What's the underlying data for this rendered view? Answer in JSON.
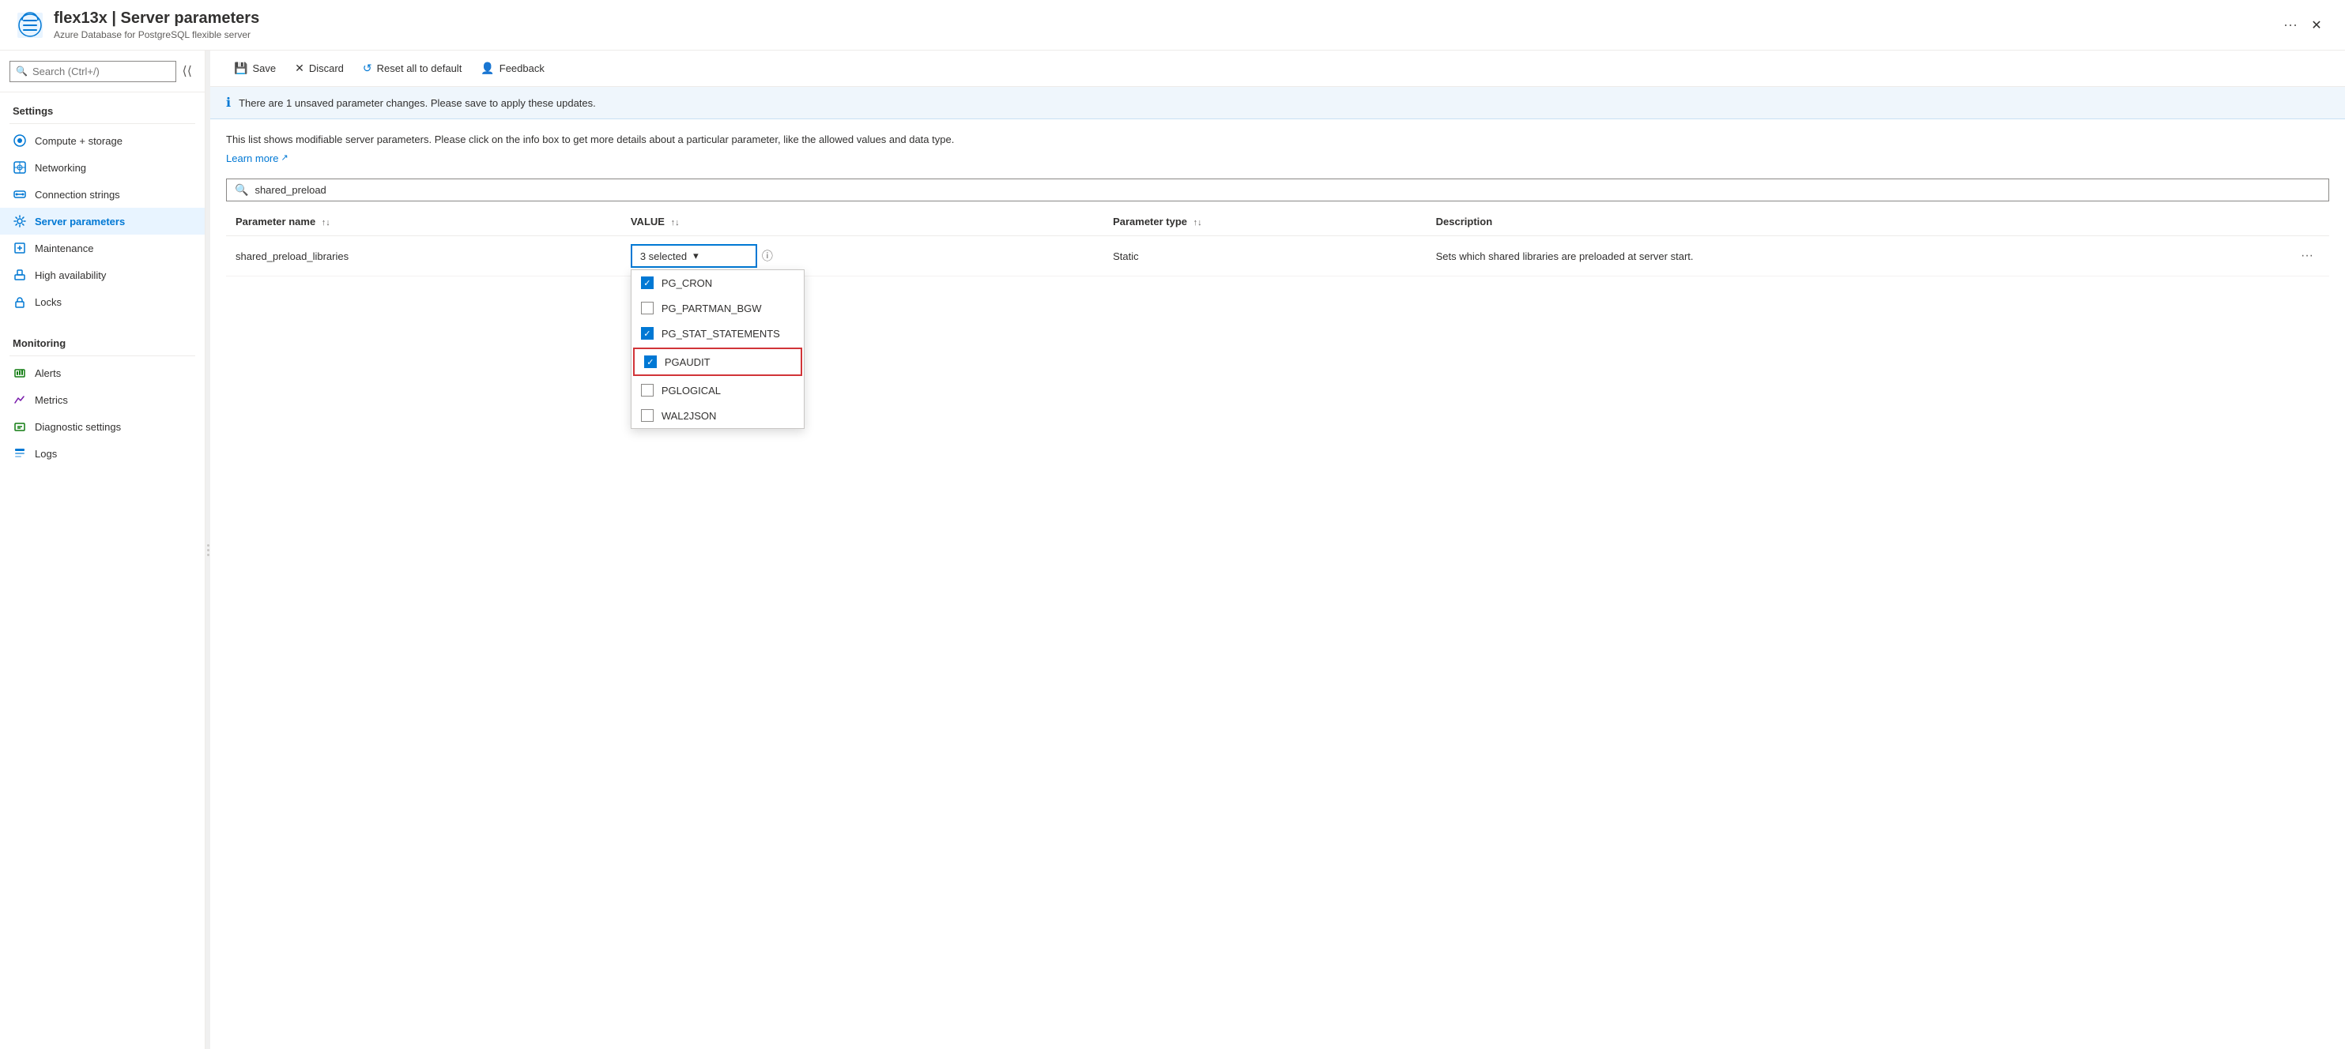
{
  "header": {
    "title": "flex13x | Server parameters",
    "subtitle": "Azure Database for PostgreSQL flexible server",
    "ellipsis": "···"
  },
  "sidebar": {
    "search_placeholder": "Search (Ctrl+/)",
    "sections": [
      {
        "label": "Settings",
        "items": [
          {
            "id": "compute-storage",
            "label": "Compute + storage",
            "icon": "compute"
          },
          {
            "id": "networking",
            "label": "Networking",
            "icon": "network"
          },
          {
            "id": "connection-strings",
            "label": "Connection strings",
            "icon": "connection"
          },
          {
            "id": "server-parameters",
            "label": "Server parameters",
            "icon": "gear",
            "active": true
          },
          {
            "id": "maintenance",
            "label": "Maintenance",
            "icon": "maintenance"
          },
          {
            "id": "high-availability",
            "label": "High availability",
            "icon": "ha"
          },
          {
            "id": "locks",
            "label": "Locks",
            "icon": "lock"
          }
        ]
      },
      {
        "label": "Monitoring",
        "items": [
          {
            "id": "alerts",
            "label": "Alerts",
            "icon": "alert"
          },
          {
            "id": "metrics",
            "label": "Metrics",
            "icon": "metrics"
          },
          {
            "id": "diagnostic-settings",
            "label": "Diagnostic settings",
            "icon": "diagnostic"
          },
          {
            "id": "logs",
            "label": "Logs",
            "icon": "logs"
          }
        ]
      }
    ]
  },
  "toolbar": {
    "save_label": "Save",
    "discard_label": "Discard",
    "reset_label": "Reset all to default",
    "feedback_label": "Feedback"
  },
  "info_banner": {
    "message": "There are 1 unsaved parameter changes.  Please save to apply these updates."
  },
  "description": {
    "text": "This list shows modifiable server parameters. Please click on the info box to get more details about a particular parameter, like the allowed values and data type.",
    "learn_more": "Learn more"
  },
  "search": {
    "placeholder": "shared_preload",
    "value": "shared_preload"
  },
  "table": {
    "columns": [
      {
        "id": "parameter_name",
        "label": "Parameter name",
        "sortable": true
      },
      {
        "id": "value",
        "label": "VALUE",
        "sortable": true
      },
      {
        "id": "parameter_type",
        "label": "Parameter type",
        "sortable": true
      },
      {
        "id": "description",
        "label": "Description",
        "sortable": false
      }
    ],
    "rows": [
      {
        "parameter_name": "shared_preload_libraries",
        "value_label": "3 selected",
        "parameter_type": "Static",
        "description": "Sets which shared libraries are preloaded at server start."
      }
    ]
  },
  "dropdown": {
    "selected_label": "3 selected",
    "items": [
      {
        "id": "pg_cron",
        "label": "PG_CRON",
        "checked": true,
        "highlighted": false
      },
      {
        "id": "pg_partman_bgw",
        "label": "PG_PARTMAN_BGW",
        "checked": false,
        "highlighted": false
      },
      {
        "id": "pg_stat_statements",
        "label": "PG_STAT_STATEMENTS",
        "checked": true,
        "highlighted": false
      },
      {
        "id": "pgaudit",
        "label": "PGAUDIT",
        "checked": true,
        "highlighted": true
      },
      {
        "id": "pglogical",
        "label": "PGLOGICAL",
        "checked": false,
        "highlighted": false
      },
      {
        "id": "wal2json",
        "label": "WAL2JSON",
        "checked": false,
        "highlighted": false
      }
    ]
  },
  "icons": {
    "search": "🔍",
    "save": "💾",
    "discard": "✕",
    "reset": "↺",
    "feedback": "👤",
    "info": "ℹ",
    "external_link": "↗",
    "chevron_down": "▾",
    "sort": "↑↓",
    "ellipsis": "···",
    "close": "✕"
  },
  "colors": {
    "accent": "#0078d4",
    "danger": "#d13438",
    "text_primary": "#323130",
    "text_secondary": "#605e5c",
    "border": "#edebe9",
    "bg_info": "#eff6fc",
    "active_bg": "#e8f4ff"
  }
}
